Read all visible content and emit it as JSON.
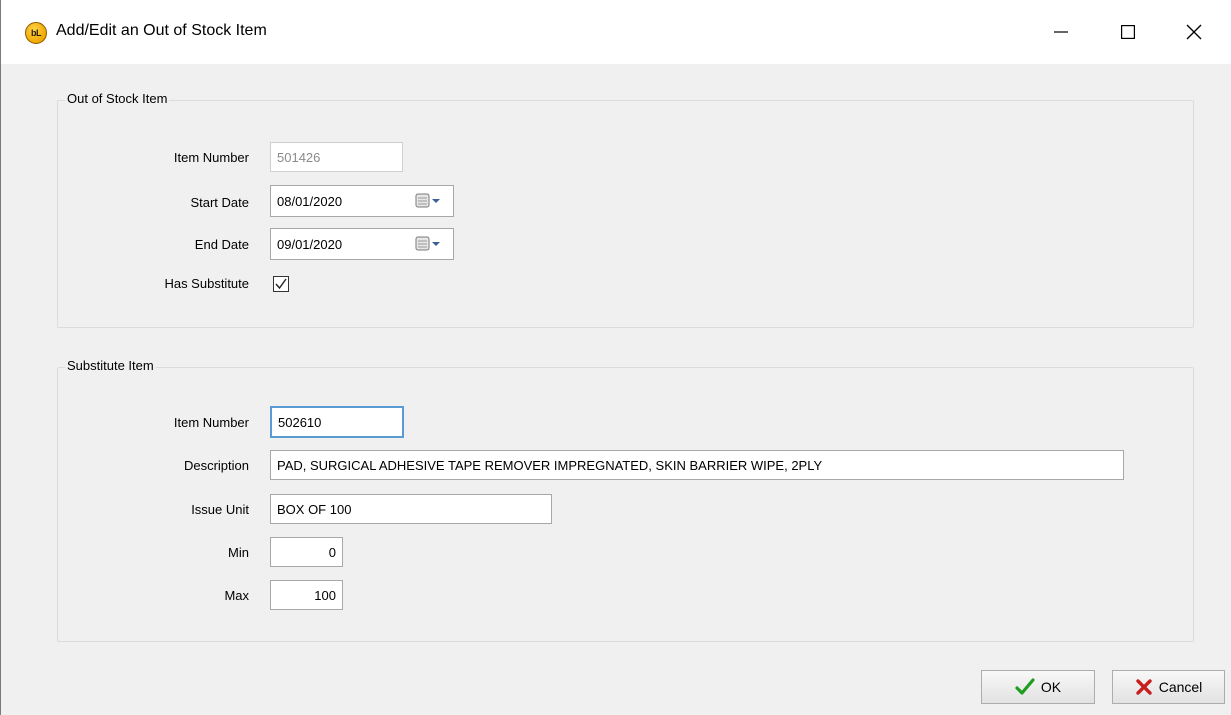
{
  "window": {
    "title": "Add/Edit an Out of Stock Item",
    "app_icon_text": "bL"
  },
  "out_of_stock": {
    "group_title": "Out of Stock Item",
    "item_number_label": "Item Number",
    "item_number_value": "501426",
    "start_date_label": "Start Date",
    "start_date_value": "08/01/2020",
    "end_date_label": "End Date",
    "end_date_value": "09/01/2020",
    "has_substitute_label": "Has Substitute",
    "has_substitute_checked": true
  },
  "substitute": {
    "group_title": "Substitute Item",
    "item_number_label": "Item Number",
    "item_number_value": "502610",
    "description_label": "Description",
    "description_value": "PAD, SURGICAL ADHESIVE TAPE REMOVER IMPREGNATED, SKIN BARRIER WIPE, 2PLY",
    "issue_unit_label": "Issue Unit",
    "issue_unit_value": "BOX OF 100",
    "min_label": "Min",
    "min_value": "0",
    "max_label": "Max",
    "max_value": "100"
  },
  "buttons": {
    "ok_label": "OK",
    "cancel_label": "Cancel"
  },
  "icons": {
    "app": "app-logo-icon",
    "minimize": "minimize-icon",
    "maximize": "maximize-icon",
    "close": "close-icon",
    "calendar": "calendar-dropdown-icon",
    "ok": "checkmark-icon",
    "cancel": "x-icon"
  },
  "colors": {
    "ok_check": "#1e9e1e",
    "cancel_x": "#c81e1e",
    "focus_border": "#5b9bd5"
  }
}
